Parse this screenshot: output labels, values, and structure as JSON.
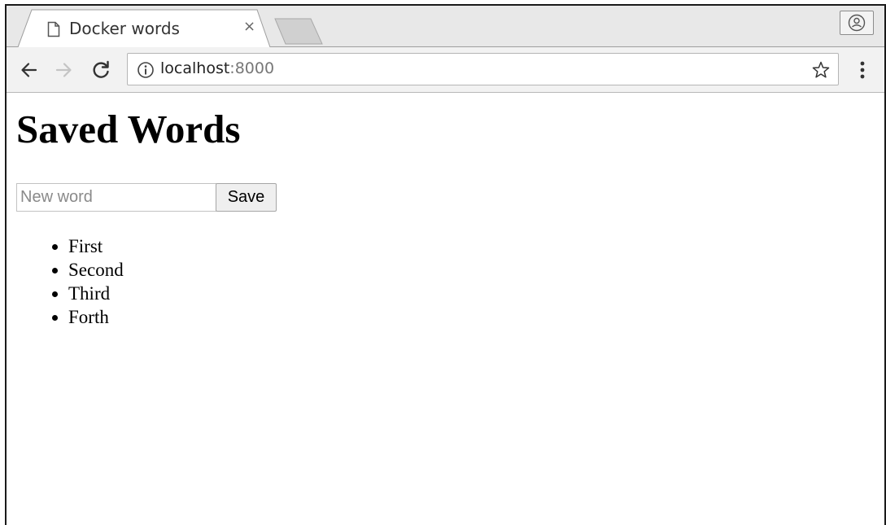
{
  "browser": {
    "tab": {
      "title": "Docker words",
      "close_glyph": "×",
      "icon": "page-icon"
    },
    "address": {
      "host": "localhost",
      "port": ":8000",
      "info_icon": "info-icon",
      "bookmark_icon": "star-icon"
    },
    "nav": {
      "back_icon": "arrow-left-icon",
      "forward_icon": "arrow-right-icon",
      "reload_icon": "reload-icon",
      "menu_icon": "vertical-dots-icon",
      "profile_icon": "user-icon"
    }
  },
  "page": {
    "heading": "Saved Words",
    "form": {
      "input_placeholder": "New word",
      "input_value": "",
      "save_label": "Save"
    },
    "words": [
      "First",
      "Second",
      "Third",
      "Forth"
    ]
  }
}
